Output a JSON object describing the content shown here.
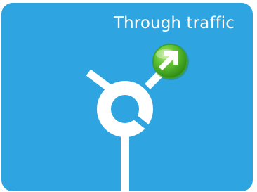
{
  "sign": {
    "title": "Through traffic",
    "background_color": "#2ea4e0",
    "road_color": "#ffffff",
    "exit_button": {
      "icon": "arrow-up-right-icon",
      "color": "#4fb72a"
    }
  }
}
